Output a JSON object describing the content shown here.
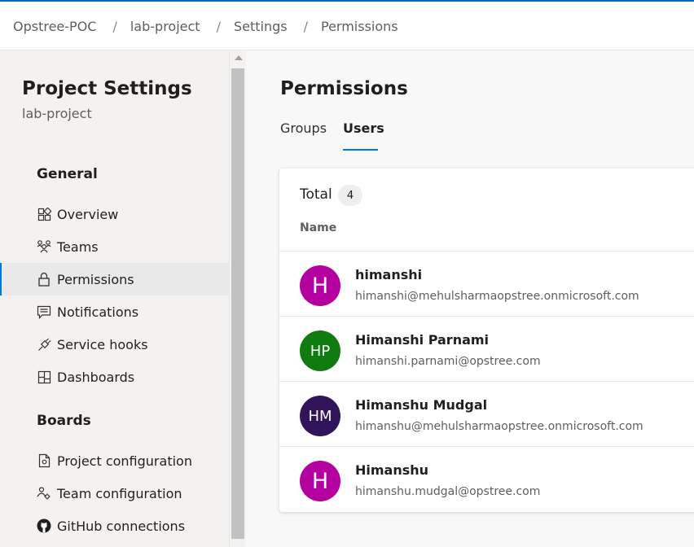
{
  "breadcrumb": [
    "Opstree-POC",
    "lab-project",
    "Settings",
    "Permissions"
  ],
  "sidebar": {
    "title": "Project Settings",
    "subtitle": "lab-project",
    "sections": [
      {
        "title": "General",
        "items": [
          {
            "label": "Overview",
            "icon": "overview-icon"
          },
          {
            "label": "Teams",
            "icon": "teams-icon"
          },
          {
            "label": "Permissions",
            "icon": "lock-icon",
            "selected": true
          },
          {
            "label": "Notifications",
            "icon": "chat-icon"
          },
          {
            "label": "Service hooks",
            "icon": "plug-icon"
          },
          {
            "label": "Dashboards",
            "icon": "dashboard-icon"
          }
        ]
      },
      {
        "title": "Boards",
        "items": [
          {
            "label": "Project configuration",
            "icon": "document-settings-icon"
          },
          {
            "label": "Team configuration",
            "icon": "team-settings-icon"
          },
          {
            "label": "GitHub connections",
            "icon": "github-icon"
          }
        ]
      }
    ]
  },
  "main": {
    "title": "Permissions",
    "tabs": [
      {
        "label": "Groups",
        "active": false
      },
      {
        "label": "Users",
        "active": true
      }
    ],
    "total_label": "Total",
    "total_count": "4",
    "column_header": "Name",
    "users": [
      {
        "initials": "H",
        "name": "himanshi",
        "email": "himanshi@mehulsharmaopstree.onmicrosoft.com",
        "color": "#b4009e"
      },
      {
        "initials": "HP",
        "name": "Himanshi Parnami",
        "email": "himanshi.parnami@opstree.com",
        "color": "#107c10"
      },
      {
        "initials": "HM",
        "name": "Himanshu Mudgal",
        "email": "himanshu@mehulsharmaopstree.onmicrosoft.com",
        "color": "#32145a"
      },
      {
        "initials": "H",
        "name": "Himanshu",
        "email": "himanshu.mudgal@opstree.com",
        "color": "#b4009e"
      }
    ]
  },
  "colors": {
    "accent": "#0078d4",
    "top_border": "#0f64b4"
  }
}
